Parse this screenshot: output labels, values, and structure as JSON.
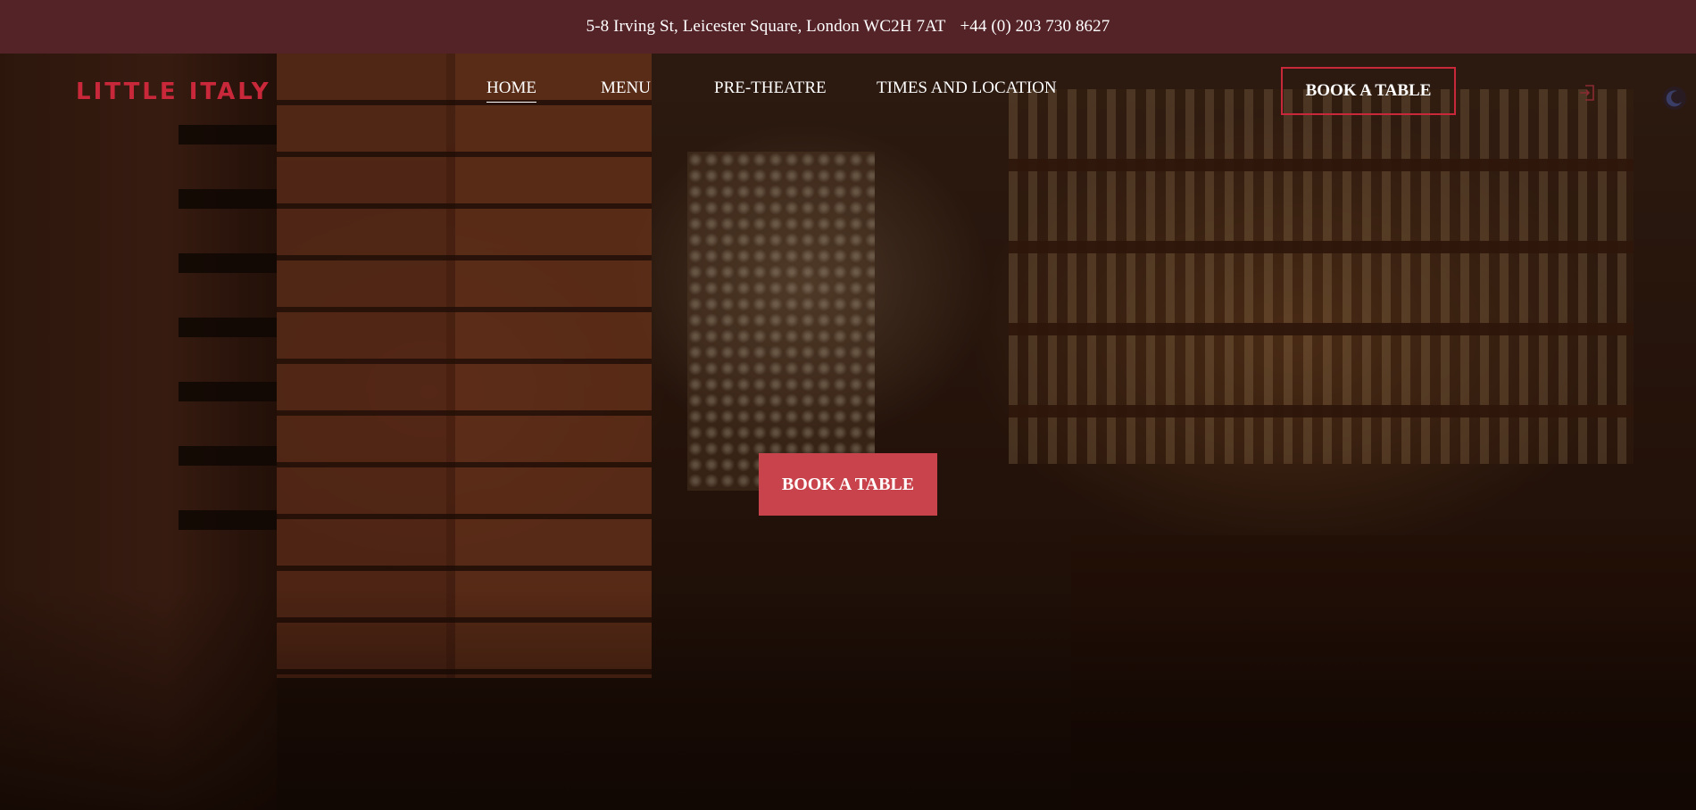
{
  "topbar": {
    "address": "5-8 Irving St, Leicester Square, London WC2H 7AT",
    "phone": "+44 (0) 203 730 8627"
  },
  "brand": {
    "logo_text": "LITTLE ITALY",
    "color": "#c9283a"
  },
  "nav": {
    "items": [
      {
        "label": "HOME",
        "active": true
      },
      {
        "label": "MENU",
        "active": false
      },
      {
        "label": "PRE-THEATRE",
        "active": false
      },
      {
        "label": "TIMES AND LOCATION",
        "active": false
      }
    ],
    "book_label": "BOOK A TABLE",
    "login_icon": "login-icon",
    "theme_icon": "moon-icon"
  },
  "hero": {
    "cta_label": "BOOK A TABLE",
    "cta_color": "#c8434b"
  },
  "colors": {
    "topbar_bg": "#542328",
    "accent": "#c9283a"
  }
}
